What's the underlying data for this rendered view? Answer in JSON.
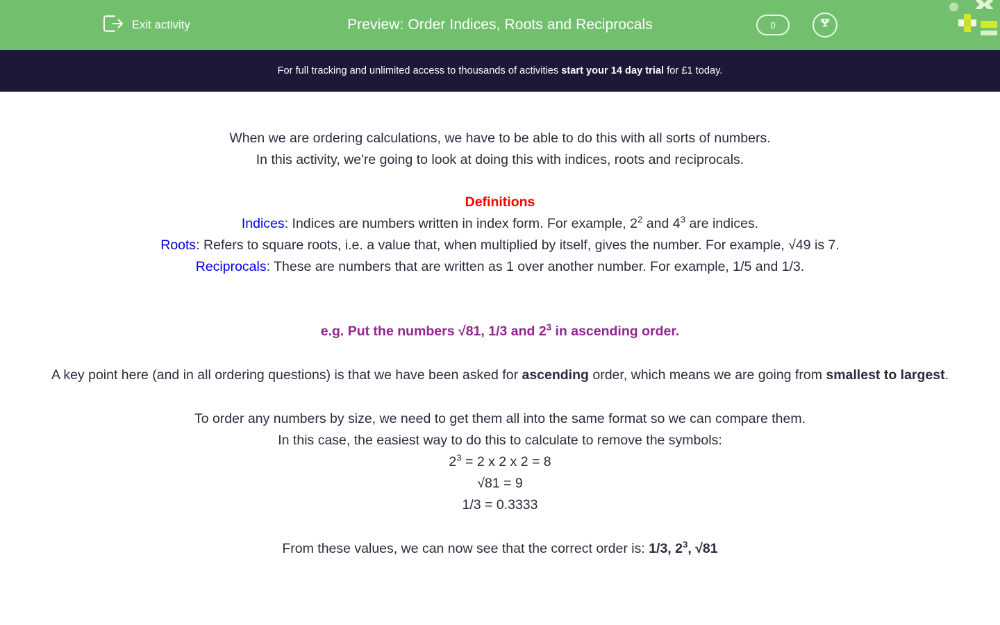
{
  "header": {
    "exit_label": "Exit activity",
    "exit_icon": "exit-arrow-icon",
    "title": "Preview: Order Indices, Roots and Reciprocals",
    "score_value": "0",
    "trophy_icon": "trophy-icon",
    "logo_icon": "education-quizzes-logo",
    "background_color": "#72c06e",
    "text_color": "#ffffff"
  },
  "promo": {
    "text_before": "For full tracking and unlimited access to thousands of activities ",
    "text_bold": "start your 14 day trial",
    "text_after": " for £1 today.",
    "background_color": "#1e1838"
  },
  "content": {
    "intro_line_1": "When we are ordering calculations, we have to be able to do this with all sorts of numbers.",
    "intro_line_2": "In this activity, we're going to look at doing this with indices, roots and reciprocals.",
    "definitions_heading": "Definitions",
    "definitions_heading_color": "#ff0000",
    "definitions": [
      {
        "term": "Indices",
        "term_color": "#0000ee",
        "text_part_1": ": Indices are numbers written in index form. For example, 2",
        "sup_1": "2",
        "text_part_2": " and 4",
        "sup_2": "3",
        "text_part_3": " are indices."
      },
      {
        "term": "Roots",
        "term_color": "#0000cd",
        "text_part_1": ": Refers to square roots, i.e. a value that, when multiplied by itself, gives the number. For example, √49 is 7."
      },
      {
        "term": "Reciprocals",
        "term_color": "#0000ee",
        "text_part_1": ": These are numbers that are written as 1 over another number. For example, 1/5 and 1/3."
      }
    ],
    "example": {
      "color": "#92278f",
      "part_1": "e.g. Put the numbers √81, 1/3 and 2",
      "sup": "3",
      "part_2": " in ascending order."
    },
    "key_point": {
      "part_1": "A key point here (and in all ordering questions) is that we have been asked for ",
      "bold_1": "ascending",
      "part_2": " order, which means we are going from ",
      "bold_2": "smallest to largest",
      "part_3": "."
    },
    "method_line_1": "To order any numbers by size, we need to get them all into the same format so we can compare them.",
    "method_line_2": "In this case, the easiest way to do this to calculate to remove the symbols:",
    "calculations": [
      {
        "base": "2",
        "sup": "3",
        "rest": " = 2 x 2 x 2 = 8"
      },
      {
        "base": "√81 = 9",
        "sup": "",
        "rest": ""
      },
      {
        "base": "1/3 = 0.3333",
        "sup": "",
        "rest": ""
      }
    ],
    "conclusion": {
      "part_1": "From these values, we can now see that the correct order is: ",
      "bold_1": "1/3, 2",
      "bold_sup": "3",
      "bold_2": ", √81"
    }
  }
}
